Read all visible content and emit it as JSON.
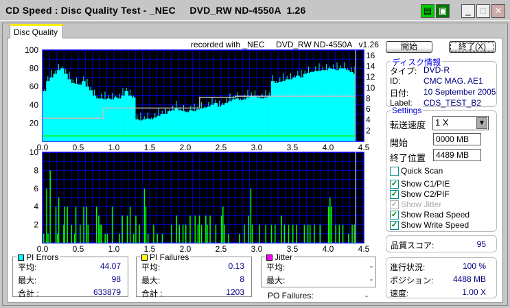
{
  "window": {
    "title": "CD Speed : Disc Quality Test - _NEC     DVD_RW ND-4550A  1.26"
  },
  "tab": "Disc Quality",
  "recorded": "recorded with _NEC     DVD_RW ND-4550A   v1.26",
  "buttons": {
    "start": "開始",
    "exit": "終了(X)"
  },
  "disc_info": {
    "title": "ディスク情報",
    "rows": [
      {
        "label": "タイプ:",
        "value": "DVD-R"
      },
      {
        "label": "ID:",
        "value": "CMC MAG. AE1"
      },
      {
        "label": "日付:",
        "value": "10 September 2005"
      },
      {
        "label": "Label:",
        "value": "CDS_TEST_B2"
      }
    ]
  },
  "settings": {
    "title": "Settings",
    "speed_label": "転送速度",
    "speed_value": "1 X",
    "start_label": "開始",
    "start_value": "0000 MB",
    "end_label": "終了位置",
    "end_value": "4489 MB",
    "checkboxes": [
      {
        "label": "Quick Scan",
        "checked": false,
        "enabled": true
      },
      {
        "label": "Show C1/PIE",
        "checked": true,
        "enabled": true
      },
      {
        "label": "Show C2/PIF",
        "checked": true,
        "enabled": true
      },
      {
        "label": "Show Jitter",
        "checked": true,
        "enabled": false
      },
      {
        "label": "Show Read Speed",
        "checked": true,
        "enabled": true
      },
      {
        "label": "Show Write Speed",
        "checked": true,
        "enabled": true
      }
    ]
  },
  "quality": {
    "label": "品質スコア:",
    "value": "95"
  },
  "progress": {
    "rows": [
      {
        "label": "進行状況:",
        "value": "100 %"
      },
      {
        "label": "ポジション:",
        "value": "4488 MB"
      },
      {
        "label": "速度:",
        "value": "1.00 X"
      }
    ]
  },
  "pi_errors": {
    "title": "PI Errors",
    "color": "#00ffff",
    "avg_label": "平均:",
    "avg": "44.07",
    "max_label": "最大:",
    "max": "98",
    "total_label": "合計 :",
    "total": "633879"
  },
  "pi_failures": {
    "title": "PI Failures",
    "color": "#ffff00",
    "avg_label": "平均:",
    "avg": "0.13",
    "max_label": "最大:",
    "max": "8",
    "total_label": "合計 :",
    "total": "1203"
  },
  "jitter": {
    "title": "Jitter",
    "color": "#ff00ff",
    "avg_label": "平均:",
    "avg": "-",
    "max_label": "最大:",
    "max": "-"
  },
  "po_failures": {
    "label": "PO Failures:",
    "value": "-"
  },
  "chart_data": [
    {
      "type": "area",
      "title": "PI Errors / Speed",
      "xlim": [
        0,
        4.5
      ],
      "ylim": [
        0,
        100
      ],
      "y2lim": [
        0,
        17
      ],
      "xticks": [
        "0.0",
        "0.5",
        "1.0",
        "1.5",
        "2.0",
        "2.5",
        "3.0",
        "3.5",
        "4.0",
        "4.5"
      ],
      "yticks": [
        "20",
        "40",
        "60",
        "80",
        "100"
      ],
      "y2ticks": [
        "2",
        "4",
        "6",
        "8",
        "10",
        "12",
        "14",
        "16"
      ],
      "x_step": 0.05,
      "pie": [
        55,
        66,
        70,
        74,
        78,
        80,
        74,
        68,
        64,
        63,
        62,
        66,
        60,
        56,
        50,
        47,
        47,
        46,
        47,
        46,
        48,
        47,
        50,
        55,
        50,
        48,
        24,
        23,
        24,
        25,
        24,
        26,
        28,
        30,
        30,
        33,
        34,
        36,
        34,
        33,
        32,
        34,
        33,
        35,
        36,
        37,
        38,
        40,
        42,
        38,
        40,
        42,
        44,
        46,
        47,
        45,
        46,
        48,
        50,
        49,
        48,
        47,
        48,
        50,
        66,
        64,
        65,
        66,
        68,
        68,
        70,
        72,
        70,
        74,
        75,
        76,
        77,
        77,
        78,
        78,
        80,
        79,
        78,
        80,
        80,
        78,
        76,
        74,
        72
      ],
      "read_speed": [
        {
          "x0": 0,
          "x1": 0.85,
          "v": 4.3
        },
        {
          "x0": 0.85,
          "x1": 2.2,
          "v": 6.2
        },
        {
          "x0": 2.2,
          "x1": 2.7,
          "v": 8.2
        },
        {
          "x0": 2.7,
          "x1": 4.38,
          "v": 8.4
        }
      ],
      "write_speed": 1.0,
      "end": 4.38
    },
    {
      "type": "bar",
      "title": "PI Failures",
      "xlim": [
        0,
        4.5
      ],
      "ylim": [
        0,
        10
      ],
      "xticks": [
        "0.0",
        "0.5",
        "1.0",
        "1.5",
        "2.0",
        "2.5",
        "3.0",
        "3.5",
        "4.0",
        "4.5"
      ],
      "yticks": [
        "2",
        "4",
        "6",
        "8",
        "10"
      ],
      "points": [
        [
          0.01,
          1
        ],
        [
          0.05,
          6
        ],
        [
          0.07,
          1
        ],
        [
          0.1,
          8
        ],
        [
          0.18,
          4
        ],
        [
          0.2,
          1
        ],
        [
          0.22,
          5
        ],
        [
          0.29,
          2
        ],
        [
          0.3,
          4
        ],
        [
          0.34,
          4
        ],
        [
          0.4,
          2
        ],
        [
          0.44,
          1
        ],
        [
          0.46,
          4
        ],
        [
          0.52,
          2
        ],
        [
          0.57,
          4
        ],
        [
          0.61,
          4
        ],
        [
          0.63,
          2
        ],
        [
          0.75,
          4
        ],
        [
          0.78,
          3
        ],
        [
          0.8,
          2
        ],
        [
          0.82,
          2
        ],
        [
          0.87,
          1
        ],
        [
          0.9,
          1
        ],
        [
          0.97,
          4
        ],
        [
          1.07,
          1
        ],
        [
          1.11,
          3
        ],
        [
          1.18,
          3
        ],
        [
          1.22,
          4
        ],
        [
          1.27,
          1
        ],
        [
          1.3,
          3
        ],
        [
          1.35,
          2
        ],
        [
          1.42,
          6
        ],
        [
          1.44,
          4
        ],
        [
          1.47,
          1
        ],
        [
          1.55,
          2
        ],
        [
          1.6,
          1
        ],
        [
          1.67,
          1
        ],
        [
          1.8,
          2
        ],
        [
          1.87,
          3
        ],
        [
          1.91,
          2
        ],
        [
          1.96,
          2
        ],
        [
          2.0,
          2
        ],
        [
          2.06,
          3
        ],
        [
          2.13,
          3
        ],
        [
          2.17,
          2
        ],
        [
          2.19,
          3
        ],
        [
          2.22,
          2
        ],
        [
          2.28,
          3
        ],
        [
          2.3,
          2
        ],
        [
          2.34,
          3
        ],
        [
          2.42,
          2
        ],
        [
          2.5,
          3
        ],
        [
          2.52,
          4
        ],
        [
          2.54,
          2
        ],
        [
          2.6,
          1
        ],
        [
          2.75,
          1
        ],
        [
          2.82,
          2
        ],
        [
          2.88,
          3
        ],
        [
          2.91,
          6
        ],
        [
          2.93,
          2
        ],
        [
          3.03,
          2
        ],
        [
          3.12,
          2
        ],
        [
          3.2,
          2
        ],
        [
          3.25,
          2
        ],
        [
          3.34,
          3
        ],
        [
          3.38,
          2
        ],
        [
          3.44,
          2
        ],
        [
          3.5,
          2
        ],
        [
          3.55,
          2
        ],
        [
          3.66,
          2
        ],
        [
          3.71,
          2
        ],
        [
          3.74,
          2
        ],
        [
          3.8,
          2
        ],
        [
          3.88,
          2
        ],
        [
          4.0,
          4
        ],
        [
          4.02,
          5
        ],
        [
          4.04,
          4
        ],
        [
          4.1,
          2
        ],
        [
          4.15,
          2
        ],
        [
          4.2,
          2
        ],
        [
          4.28,
          1
        ],
        [
          4.33,
          2
        ],
        [
          4.36,
          2
        ]
      ]
    }
  ]
}
